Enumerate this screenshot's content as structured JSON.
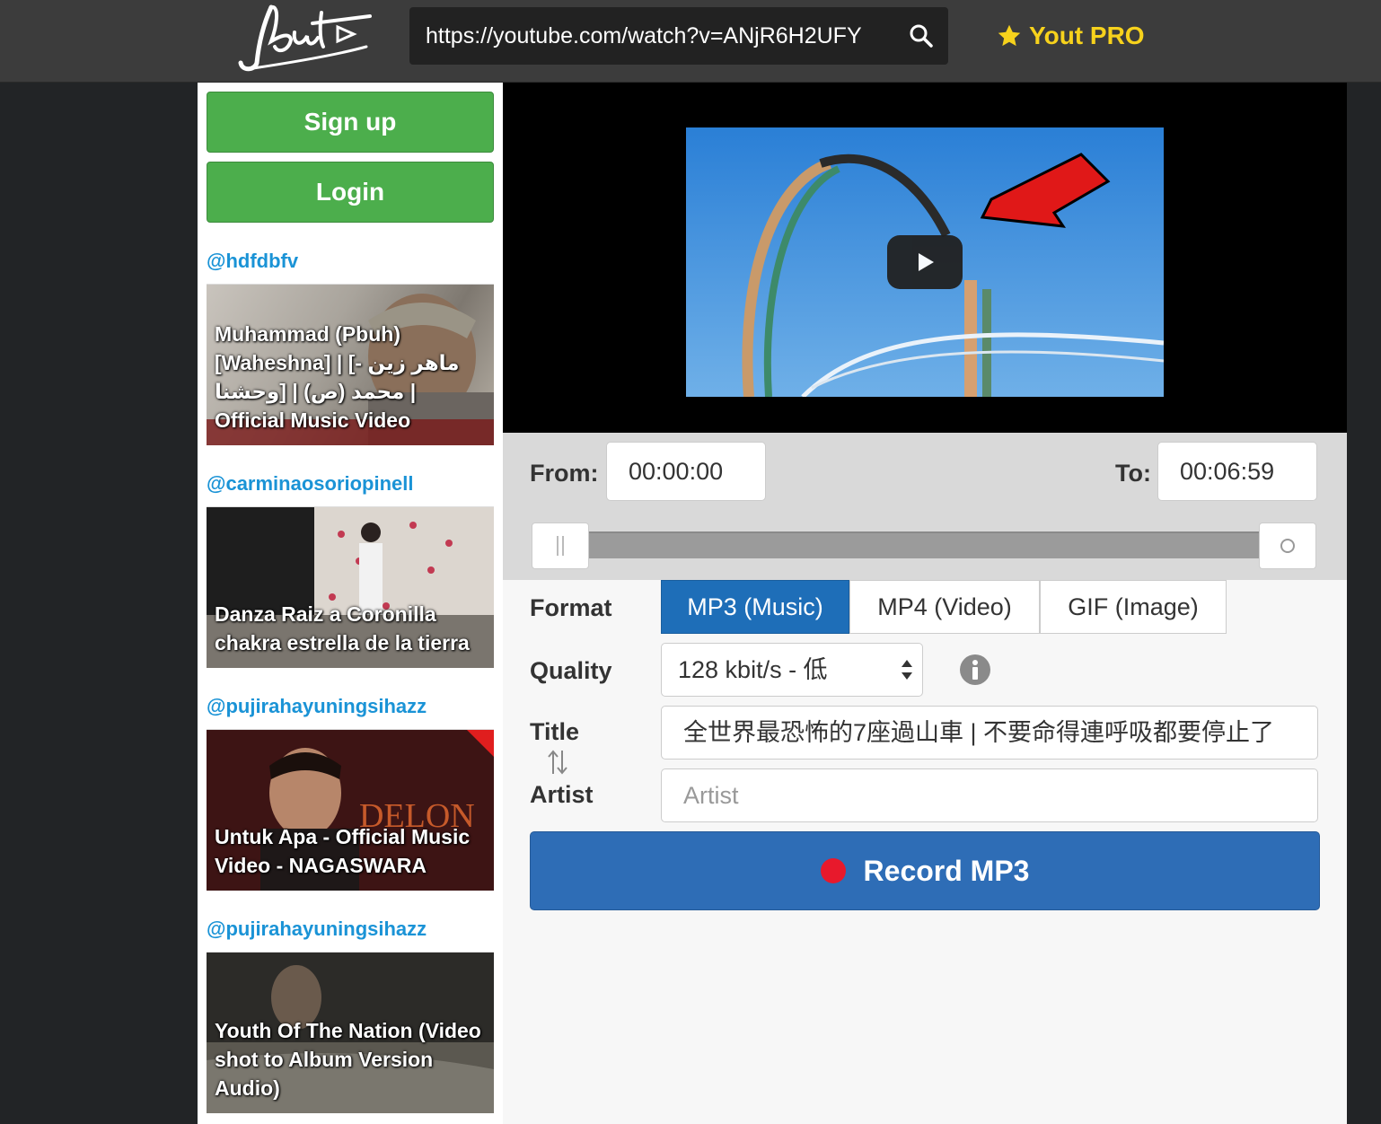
{
  "header": {
    "logo_text": "Yout",
    "url": "https://youtube.com/watch?v=ANjR6H2UFY",
    "pro_label": "Yout PRO",
    "accent_color": "#f7d21c"
  },
  "sidebar": {
    "signup_label": "Sign up",
    "login_label": "Login",
    "items": [
      {
        "user": "@hdfdbfv",
        "title": "Muhammad (Pbuh) [Waheshna] | [ماهر زين - محمد (ص) | [وحشنا | Official Music Video"
      },
      {
        "user": "@carminaosoriopinell",
        "title": "Danza Raiz a Coronilla chakra estrella de la tierra"
      },
      {
        "user": "@pujirahayuningsihazz",
        "title": "Untuk Apa - Official Music Video - NAGASWARA"
      },
      {
        "user": "@pujirahayuningsihazz",
        "title": "Youth Of The Nation (Video shot to Album Version Audio)"
      }
    ]
  },
  "range": {
    "from_label": "From:",
    "from_value": "00:00:00",
    "to_label": "To:",
    "to_value": "00:06:59"
  },
  "form": {
    "format_label": "Format",
    "formats": [
      "MP3 (Music)",
      "MP4 (Video)",
      "GIF (Image)"
    ],
    "selected_format": "MP3 (Music)",
    "quality_label": "Quality",
    "quality_value": "128 kbit/s - 低",
    "title_label": "Title",
    "title_value": "全世界最恐怖的7座過山車 | 不要命得連呼吸都要停止了",
    "artist_label": "Artist",
    "artist_placeholder": "Artist",
    "record_label": "Record MP3"
  }
}
